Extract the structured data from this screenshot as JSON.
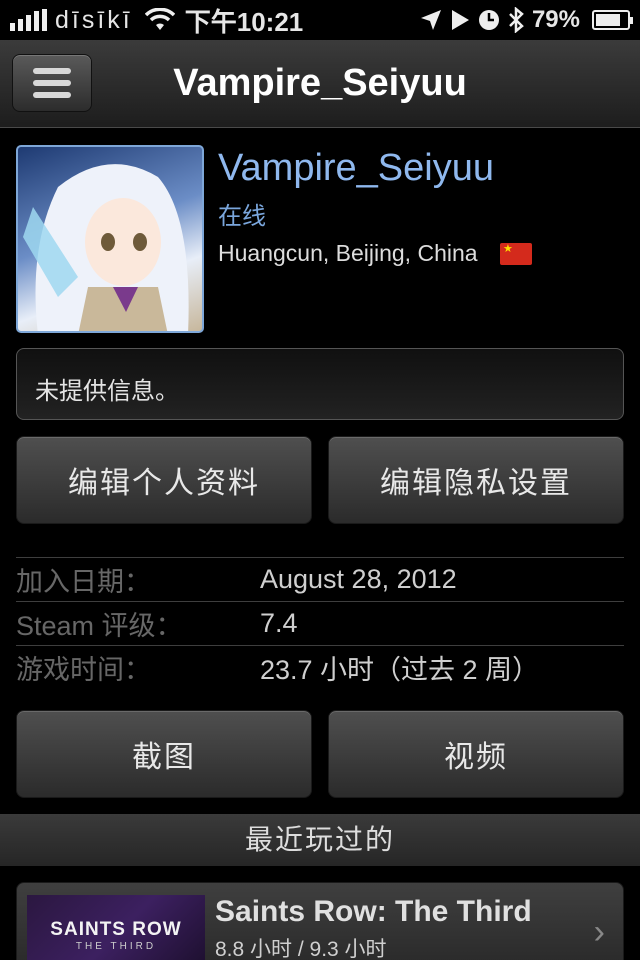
{
  "status_bar": {
    "carrier": "dīsīkī",
    "time": "下午10:21",
    "battery": "79%",
    "battery_level": 0.79,
    "icons": [
      "signal-icon",
      "wifi-icon",
      "location-arrow-icon",
      "play-icon",
      "clock-icon",
      "bluetooth-icon",
      "battery-icon"
    ]
  },
  "nav": {
    "title": "Vampire_Seiyuu",
    "menu_icon": "hamburger-menu-icon"
  },
  "profile": {
    "username": "Vampire_Seiyuu",
    "status": "在线",
    "location": "Huangcun, Beijing, China",
    "summary": "未提供信息。"
  },
  "buttons": {
    "edit_profile": "编辑个人资料",
    "edit_privacy": "编辑隐私设置",
    "screenshots": "截图",
    "videos": "视频"
  },
  "stats": [
    {
      "label": "加入日期：",
      "value": "August 28, 2012"
    },
    {
      "label": "Steam 评级：",
      "value": "7.4"
    },
    {
      "label": "游戏时间：",
      "value": "23.7 小时（过去 2 周）"
    }
  ],
  "recent": {
    "header": "最近玩过的",
    "games": [
      {
        "title": "Saints Row: The Third",
        "hours": "8.8 小时 / 9.3 小时",
        "thumb_line1": "SAINTS ROW",
        "thumb_line2": "THE THIRD"
      }
    ]
  },
  "colors": {
    "accent_blue": "#8fb8ee",
    "background": "#000000"
  }
}
